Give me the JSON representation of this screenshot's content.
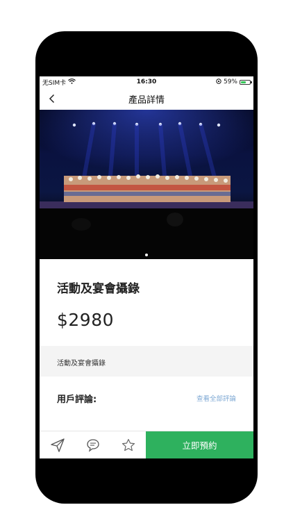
{
  "status_bar": {
    "carrier": "无SIM卡",
    "time": "16:30",
    "battery_percent": "59%",
    "battery_level": 0.59,
    "icons": [
      "wifi-icon",
      "orientation-lock-icon",
      "battery-charging-icon"
    ]
  },
  "nav": {
    "title": "產品詳情",
    "back_icon": "chevron-left-icon"
  },
  "carousel": {
    "image": "stage-performance-photo",
    "page_count": 1,
    "active_page": 1
  },
  "product": {
    "title": "活動及宴會攝錄",
    "price": "$2980",
    "description": "活動及宴會攝錄"
  },
  "reviews": {
    "label": "用戶評論:",
    "view_all": "查看全部評論"
  },
  "bottom_bar": {
    "icons": [
      "share-send-icon",
      "message-icon",
      "favorite-star-icon"
    ],
    "book_label": "立即預約",
    "book_color": "#2eb15e"
  }
}
